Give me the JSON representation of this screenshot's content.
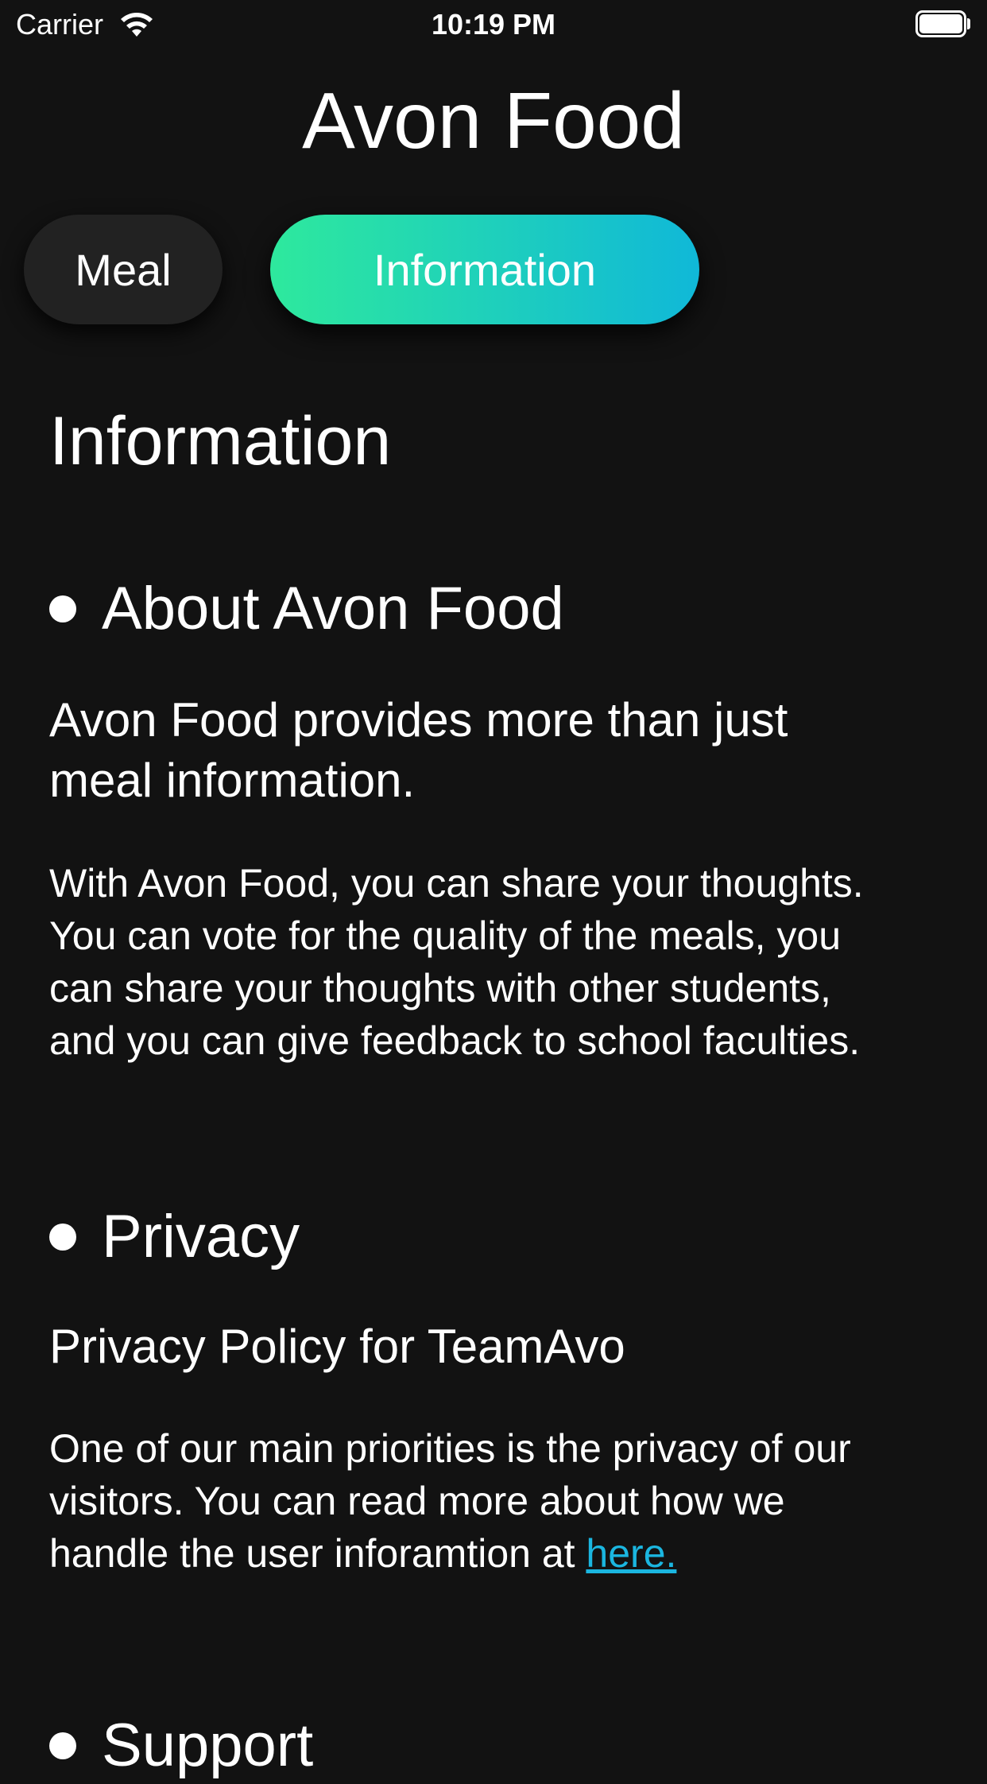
{
  "status_bar": {
    "carrier": "Carrier",
    "time": "10:19 PM",
    "wifi_icon": "wifi-icon",
    "battery_icon": "battery-full-icon"
  },
  "app": {
    "title": "Avon Food"
  },
  "segments": {
    "meal_label": "Meal",
    "info_label": "Information",
    "selected": "Information",
    "gradient_start": "#2ee99d",
    "gradient_end": "#10b8d8"
  },
  "page": {
    "heading": "Information",
    "sections": [
      {
        "title": "About Avon Food",
        "subtitle_line1": "Avon Food provides more than just",
        "subtitle_line2": "meal information.",
        "body_lines": [
          "With Avon Food, you can share your thoughts.",
          "You can vote for the quality of the meals, you",
          "can share your thoughts with other students,",
          "and you can give feedback to school faculties."
        ]
      },
      {
        "title": "Privacy",
        "subtitle": "Privacy Policy for TeamAvo",
        "body_lines": [
          "One of our main priorities is the privacy of our",
          "visitors. You can read more about how we",
          "handle the user inforamtion at "
        ],
        "link_text": "here."
      },
      {
        "title": "Support"
      }
    ]
  },
  "colors": {
    "background": "#121212",
    "link": "#1bb6e0",
    "inactive_segment": "#222222"
  }
}
